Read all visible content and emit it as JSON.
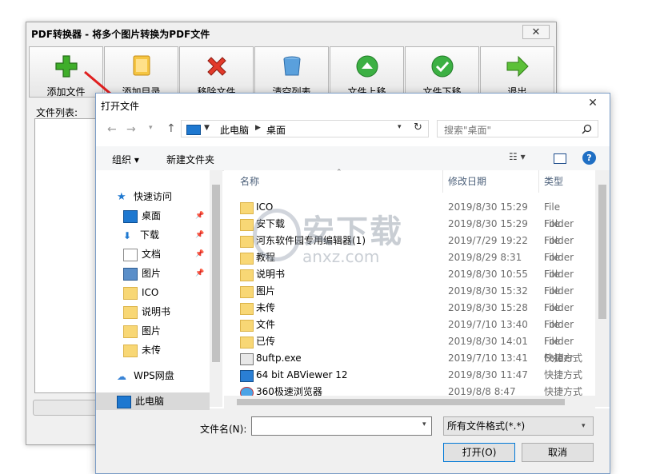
{
  "app": {
    "title": "PDF转换器 - 将多个图片转换为PDF文件",
    "close": "✕",
    "toolbar": [
      "添加文件",
      "添加目录",
      "移除文件",
      "清空列表",
      "文件上移",
      "文件下移",
      "退出"
    ],
    "list_label": "文件列表:"
  },
  "dialog": {
    "title": "打开文件",
    "close": "✕",
    "breadcrumb": [
      "此电脑",
      "桌面"
    ],
    "search_placeholder": "搜索\"桌面\"",
    "organize": "组织 ▾",
    "new_folder": "新建文件夹",
    "nav": [
      {
        "label": "快速访问",
        "icon": "star-icon"
      },
      {
        "label": "桌面",
        "icon": "desktop-icon",
        "pinned": true
      },
      {
        "label": "下载",
        "icon": "download-icon",
        "pinned": true
      },
      {
        "label": "文档",
        "icon": "document-icon",
        "pinned": true
      },
      {
        "label": "图片",
        "icon": "picture-icon",
        "pinned": true
      },
      {
        "label": "ICO",
        "icon": "folder-icon"
      },
      {
        "label": "说明书",
        "icon": "folder-icon"
      },
      {
        "label": "图片",
        "icon": "folder-icon"
      },
      {
        "label": "未传",
        "icon": "folder-icon"
      },
      {
        "label": "WPS网盘",
        "icon": "cloud-icon"
      },
      {
        "label": "此电脑",
        "icon": "computer-icon"
      }
    ],
    "columns": {
      "name": "名称",
      "date": "修改日期",
      "type": "类型"
    },
    "files": [
      {
        "name": "ICO",
        "date": "2019/8/30 15:29",
        "type": "File Folder",
        "icon": "folder-icon"
      },
      {
        "name": "安下载",
        "date": "2019/8/30 15:29",
        "type": "File Folder",
        "icon": "folder-icon"
      },
      {
        "name": "河东软件园专用编辑器(1)",
        "date": "2019/7/29 19:22",
        "type": "File Folder",
        "icon": "folder-icon"
      },
      {
        "name": "教程",
        "date": "2019/8/29 8:31",
        "type": "File Folder",
        "icon": "folder-icon"
      },
      {
        "name": "说明书",
        "date": "2019/8/30 10:55",
        "type": "File Folder",
        "icon": "folder-icon"
      },
      {
        "name": "图片",
        "date": "2019/8/30 15:32",
        "type": "File Folder",
        "icon": "folder-icon"
      },
      {
        "name": "未传",
        "date": "2019/8/30 15:28",
        "type": "File Folder",
        "icon": "folder-icon"
      },
      {
        "name": "文件",
        "date": "2019/7/10 13:40",
        "type": "File Folder",
        "icon": "folder-icon"
      },
      {
        "name": "已传",
        "date": "2019/8/30 14:01",
        "type": "File Folder",
        "icon": "folder-icon"
      },
      {
        "name": "8uftp.exe",
        "date": "2019/7/10 13:41",
        "type": "快捷方式",
        "icon": "ftp-icon"
      },
      {
        "name": "64 bit ABViewer 12",
        "date": "2019/8/30 11:47",
        "type": "快捷方式",
        "icon": "abviewer-icon"
      },
      {
        "name": "360极速浏览器",
        "date": "2019/8/8 8:47",
        "type": "快捷方式",
        "icon": "browser-icon"
      }
    ],
    "filename_label": "文件名(N):",
    "filename_value": "",
    "filetype": "所有文件格式(*.*)",
    "open_button": "打开(O)",
    "cancel_button": "取消"
  },
  "watermark": {
    "line1": "安下载",
    "line2": "anxz.com"
  },
  "colors": {
    "accent": "#0078d7",
    "folder": "#f8d775",
    "arrow": "#e02020"
  }
}
